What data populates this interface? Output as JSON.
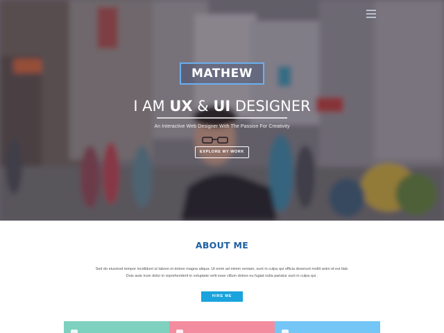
{
  "hero": {
    "name": "MATHEW",
    "headline_prefix": "I AM ",
    "headline_ux": "UX",
    "headline_amp": " & ",
    "headline_ui": "UI",
    "headline_suffix": " DESIGNER",
    "tagline": "An Interactive Web Designer With The Passion For Creativity",
    "explore_button": "EXPLORE MY WORK",
    "menu_icon": "hamburger-menu-icon"
  },
  "about": {
    "title": "ABOUT ME",
    "line1": "Sed do eiusmod tempor incididunt ut labore et dolore magna aliqua. Ut enim ad minim veniam, sunt in culpa qui officia deserunt mollit anim id est tlab.",
    "line2": "Duis aute irure dolor in reprehenderit in voluptate velit esse cillum dolore eu fugiat nulla pariatur sunt in culpa qui .",
    "hire_button": "HIRE ME"
  },
  "cards": [
    {
      "color": "#7fd1bf",
      "icon": "cup-icon"
    },
    {
      "color": "#f28c9e",
      "icon": "graduation-cap-icon"
    },
    {
      "color": "#73c6f5",
      "icon": "book-icon"
    }
  ],
  "colors": {
    "accent_blue": "#1f5fa3",
    "button_blue": "#1aa3dc",
    "name_border": "#6ab0f0"
  }
}
